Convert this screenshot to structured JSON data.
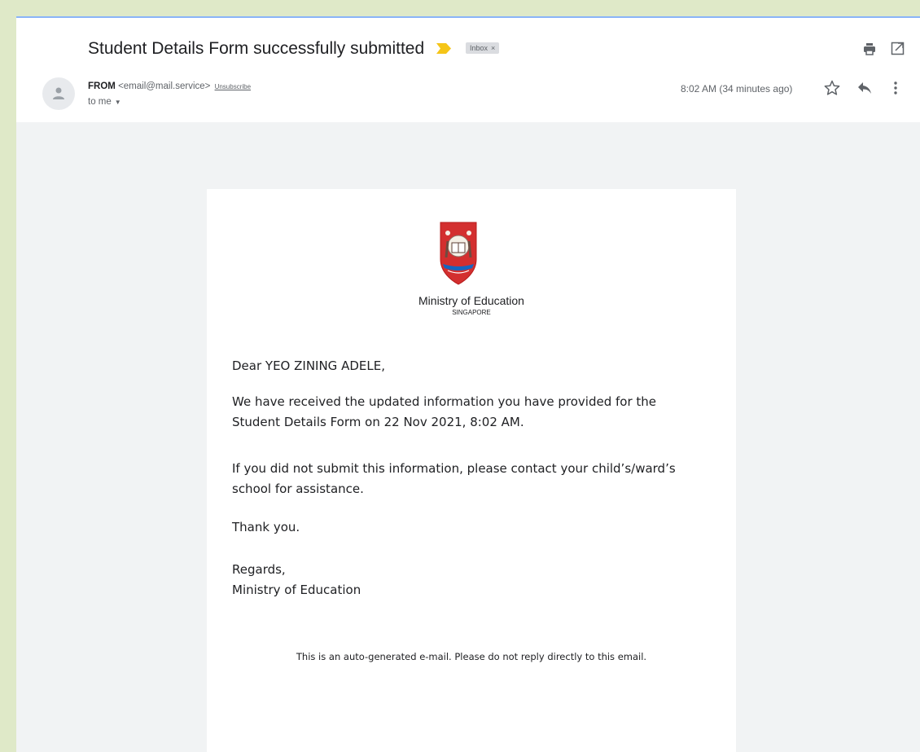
{
  "email": {
    "subject": "Student Details Form successfully submitted",
    "label_chip": "Inbox",
    "label_chip_close": "×",
    "sender": {
      "name": "FROM",
      "address": "<email@mail.service>",
      "unsubscribe_label": "Unsubscribe"
    },
    "recipient": "to me",
    "timestamp": "8:02 AM (34 minutes ago)"
  },
  "toolbar": {
    "icons": [
      "print-icon",
      "open-in-new-window-icon",
      "star-icon",
      "reply-icon",
      "more-options-icon",
      "important-marker-icon"
    ]
  },
  "colors": {
    "important_marker": "#f5c518",
    "crest_red": "#d32f2f",
    "crest_blue": "#1565c0",
    "page_background": "#dfe9c8"
  },
  "message": {
    "logo": {
      "name": "Ministry of Education",
      "country": "SINGAPORE"
    },
    "greeting": "Dear YEO ZINING ADELE,",
    "paragraph_1_line_1": "We have received the updated information you have provided for the",
    "paragraph_1_line_2": "Student Details Form on 22 Nov 2021, 8:02 AM.",
    "paragraph_2_line_1": "If you did not submit this information, please contact your child’s/ward’s",
    "paragraph_2_line_2": "school for assistance.",
    "thanks": "Thank you.",
    "signoff": "Regards,",
    "signature": "Ministry of Education",
    "footer_note": "This is an auto-generated e-mail. Please do not reply directly to this email."
  }
}
